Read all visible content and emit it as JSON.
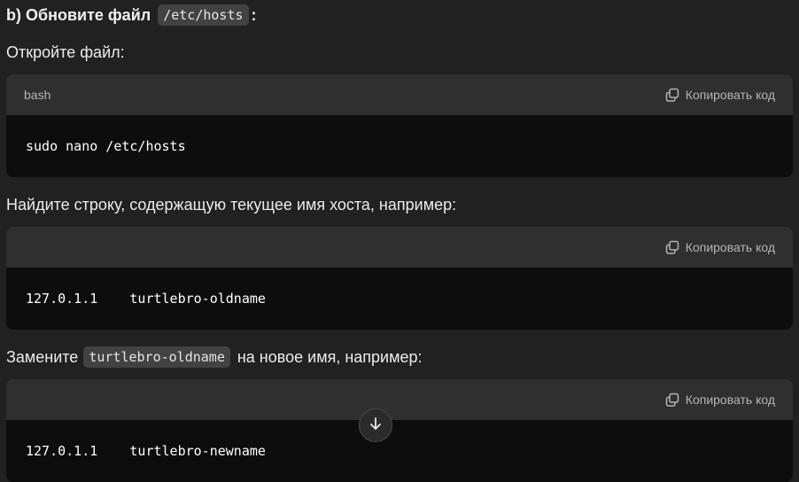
{
  "heading": {
    "prefix": "b) Обновите файл",
    "code": "/etc/hosts",
    "suffix": ":"
  },
  "step1": {
    "text": "Откройте файл:"
  },
  "block1": {
    "language": "bash",
    "copy_label": "Копировать код",
    "code": "sudo nano /etc/hosts"
  },
  "step2": {
    "text": "Найдите строку, содержащую текущее имя хоста, например:"
  },
  "block2": {
    "language": "",
    "copy_label": "Копировать код",
    "code": "127.0.1.1    turtlebro-oldname"
  },
  "step3": {
    "prefix": "Замените",
    "code": "turtlebro-oldname",
    "suffix": "на новое имя, например:"
  },
  "block3": {
    "language": "",
    "copy_label": "Копировать код",
    "code": "127.0.1.1    turtlebro-newname"
  },
  "icons": {
    "copy": "copy-icon",
    "scroll": "arrow-down-icon"
  },
  "colors": {
    "background": "#212121",
    "code_header": "#2f2f2f",
    "code_body": "#0d0d0d",
    "inline_code": "#424242"
  }
}
